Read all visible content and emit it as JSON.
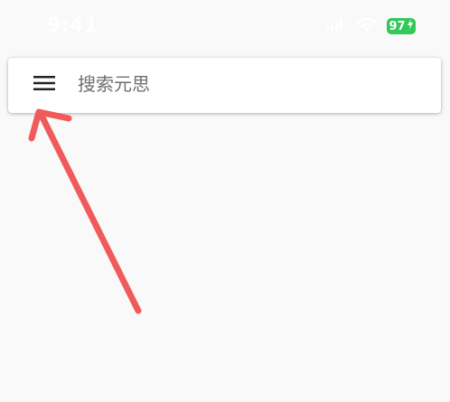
{
  "status_bar": {
    "time": "9:41",
    "battery_level": "97",
    "battery_charging": true,
    "battery_color": "#34c759"
  },
  "search_bar": {
    "menu_icon": "hamburger-menu-icon",
    "placeholder": "搜索元思",
    "value": ""
  },
  "annotation": {
    "type": "arrow",
    "color": "#f05a5a",
    "points_to": "menu-button"
  }
}
